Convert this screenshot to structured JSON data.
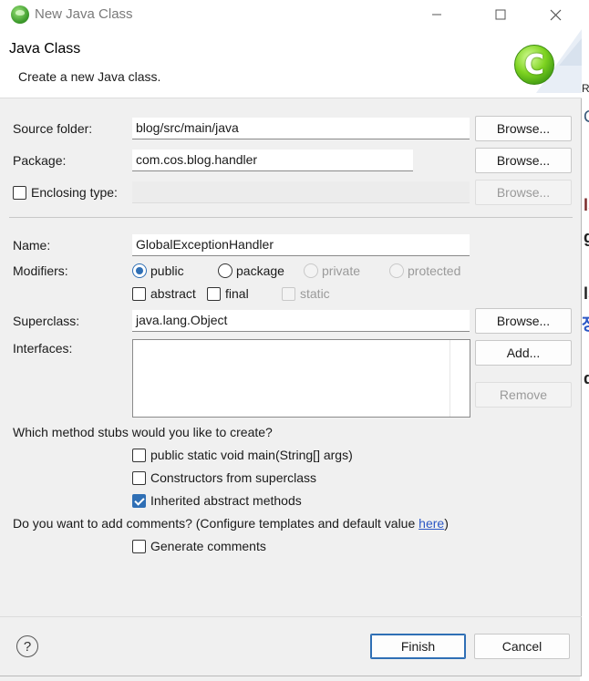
{
  "window": {
    "title": "New Java Class",
    "minimize_glyph": "☐",
    "maximize_glyph": "☐",
    "close_glyph": "✕"
  },
  "banner": {
    "title": "Java Class",
    "description": "Create a new Java class."
  },
  "form": {
    "source_folder": {
      "label": "Source folder:",
      "value": "blog/src/main/java",
      "button": "Browse..."
    },
    "package": {
      "label": "Package:",
      "value": "com.cos.blog.handler",
      "button": "Browse..."
    },
    "enclosing_type": {
      "label": "Enclosing type:",
      "value": "",
      "button": "Browse...",
      "checked": false
    },
    "name": {
      "label": "Name:",
      "value": "GlobalExceptionHandler"
    },
    "modifiers": {
      "label": "Modifiers:",
      "access": [
        {
          "label": "public",
          "selected": true,
          "enabled": true
        },
        {
          "label": "package",
          "selected": false,
          "enabled": true
        },
        {
          "label": "private",
          "selected": false,
          "enabled": false
        },
        {
          "label": "protected",
          "selected": false,
          "enabled": false
        }
      ],
      "flags": [
        {
          "label": "abstract",
          "checked": false,
          "enabled": true
        },
        {
          "label": "final",
          "checked": false,
          "enabled": true
        },
        {
          "label": "static",
          "checked": false,
          "enabled": false
        }
      ]
    },
    "superclass": {
      "label": "Superclass:",
      "value": "java.lang.Object",
      "button": "Browse..."
    },
    "interfaces": {
      "label": "Interfaces:",
      "add_button": "Add...",
      "remove_button": "Remove"
    },
    "stubs": {
      "question": "Which method stubs would you like to create?",
      "options": [
        {
          "label": "public static void main(String[] args)",
          "checked": false
        },
        {
          "label": "Constructors from superclass",
          "checked": false
        },
        {
          "label": "Inherited abstract methods",
          "checked": true
        }
      ]
    },
    "comments": {
      "question_prefix": "Do you want to add comments? (Configure templates and default value ",
      "link": "here",
      "question_suffix": ")",
      "option": {
        "label": "Generate comments",
        "checked": false
      }
    }
  },
  "footer": {
    "help_glyph": "?",
    "finish": "Finish",
    "cancel": "Cancel"
  },
  "background_fragments": [
    "Re",
    "C",
    "ls",
    "g",
    "ls",
    "장",
    "d"
  ],
  "colors": {
    "accent": "#2f6fb5",
    "link": "#2b57c5",
    "dialog_bg": "#f0f0f0"
  }
}
